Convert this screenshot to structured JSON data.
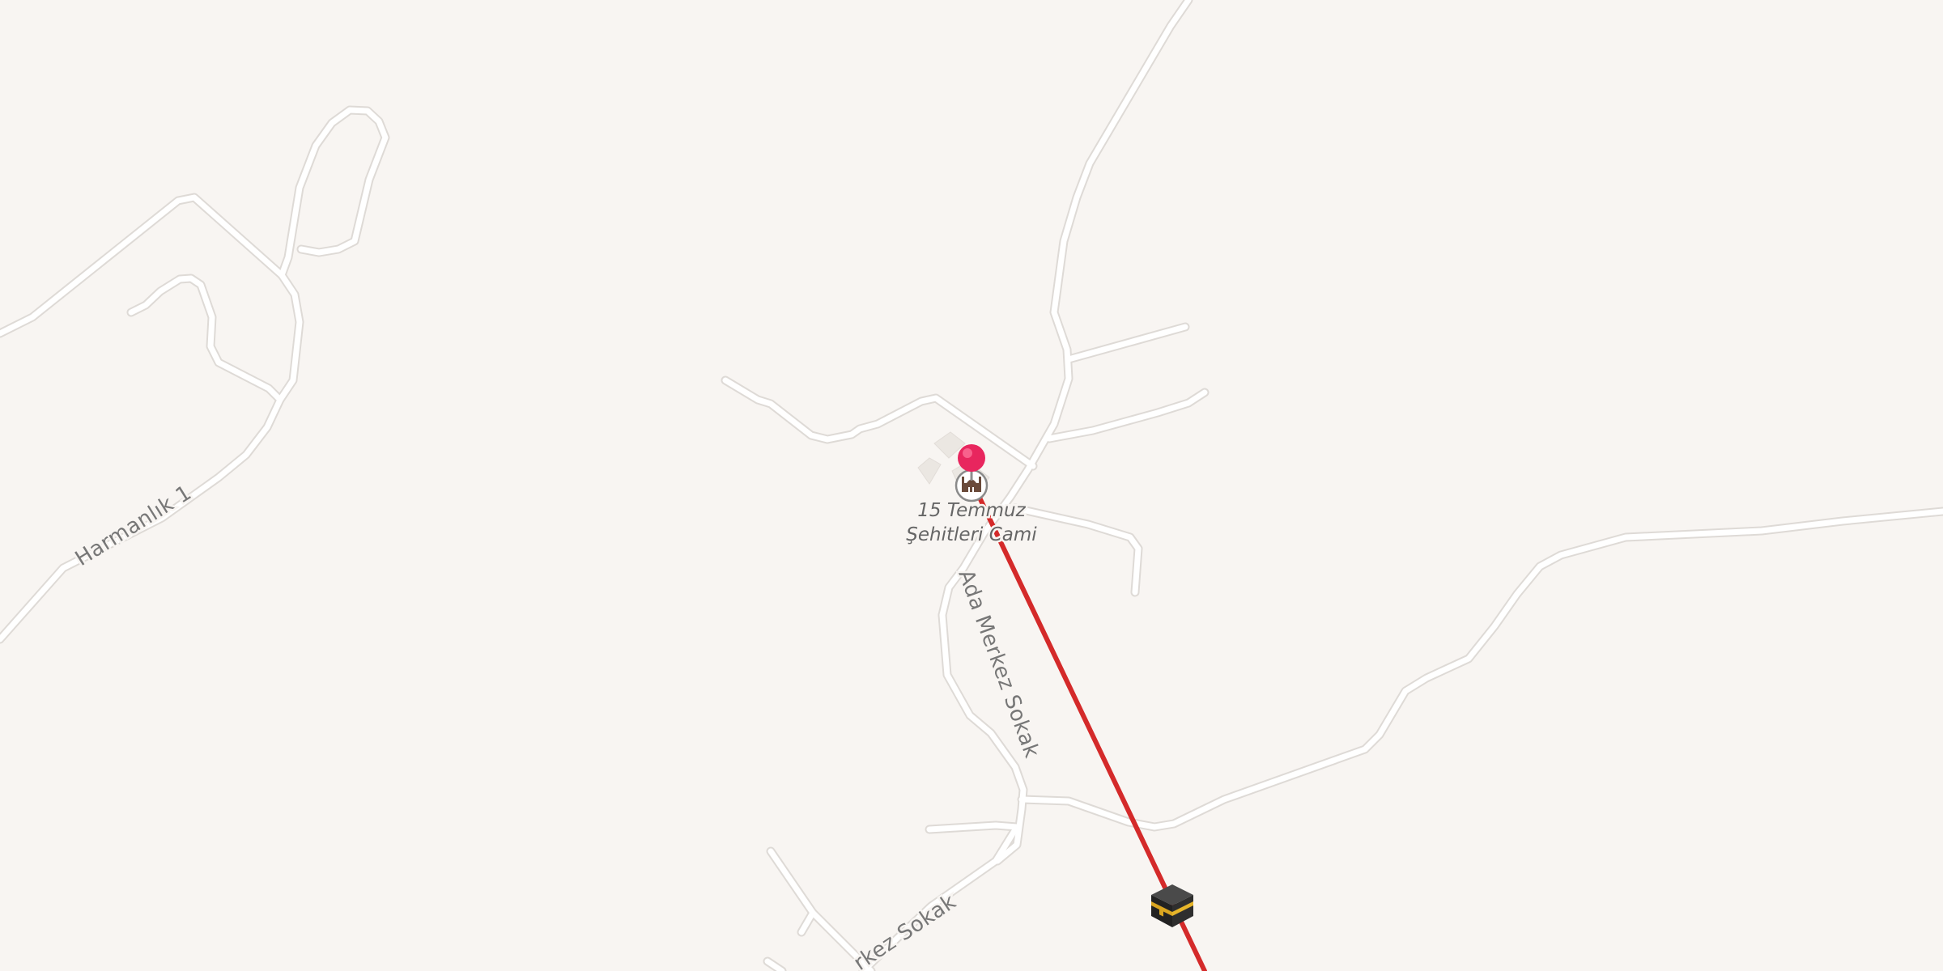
{
  "map": {
    "streets": {
      "harmanlik": "Harmanlık 1",
      "ada_merkez": "Ada Merkez Sokak",
      "merkez_partial": "rkez Sokak"
    },
    "poi": {
      "name_line1": "15 Temmuz",
      "name_line2": "Şehitleri Cami",
      "icon": "mosque-icon"
    },
    "marker": {
      "icon": "location-pin-icon",
      "color": "#e8265e"
    },
    "qibla": {
      "icon": "kaaba-icon",
      "line_color": "#d42a2a"
    },
    "colors": {
      "background": "#f8f5f2",
      "road": "#ffffff",
      "road_casing": "#dedad6"
    }
  }
}
